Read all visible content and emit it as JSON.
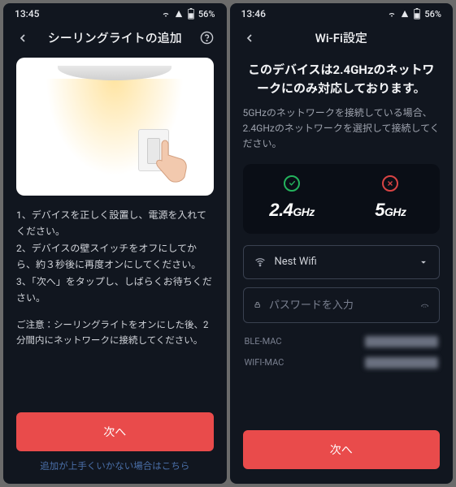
{
  "left": {
    "status": {
      "time": "13:45",
      "battery": "56%"
    },
    "appbar": {
      "title": "シーリングライトの追加"
    },
    "instructions": "1、デバイスを正しく設置し、電源を入れてください。\n2、デバイスの壁スイッチをオフにしてから、約３秒後に再度オンにしてください。\n3、「次へ」をタップし、しばらくお待ちください。",
    "note": "ご注意：シーリングライトをオンにした後、2分間内にネットワークに接続してください。",
    "primary": "次へ",
    "link": "追加が上手くいかない場合はこちら"
  },
  "right": {
    "status": {
      "time": "13:46",
      "battery": "56%"
    },
    "appbar": {
      "title": "Wi-Fi設定"
    },
    "heading": "このデバイスは2.4GHzのネットワークにのみ対応しております。",
    "subtext": "5GHzのネットワークを接続している場合、2.4GHzのネットワークを選択して接続してください。",
    "freq": {
      "ok": "2.4",
      "ok_unit": "GHz",
      "bad": "5",
      "bad_unit": "GHz"
    },
    "wifi": {
      "ssid": "Nest Wifi",
      "password_placeholder": "パスワードを入力"
    },
    "mac": {
      "ble_label": "BLE-MAC",
      "wifi_label": "WIFI-MAC"
    },
    "primary": "次へ"
  }
}
